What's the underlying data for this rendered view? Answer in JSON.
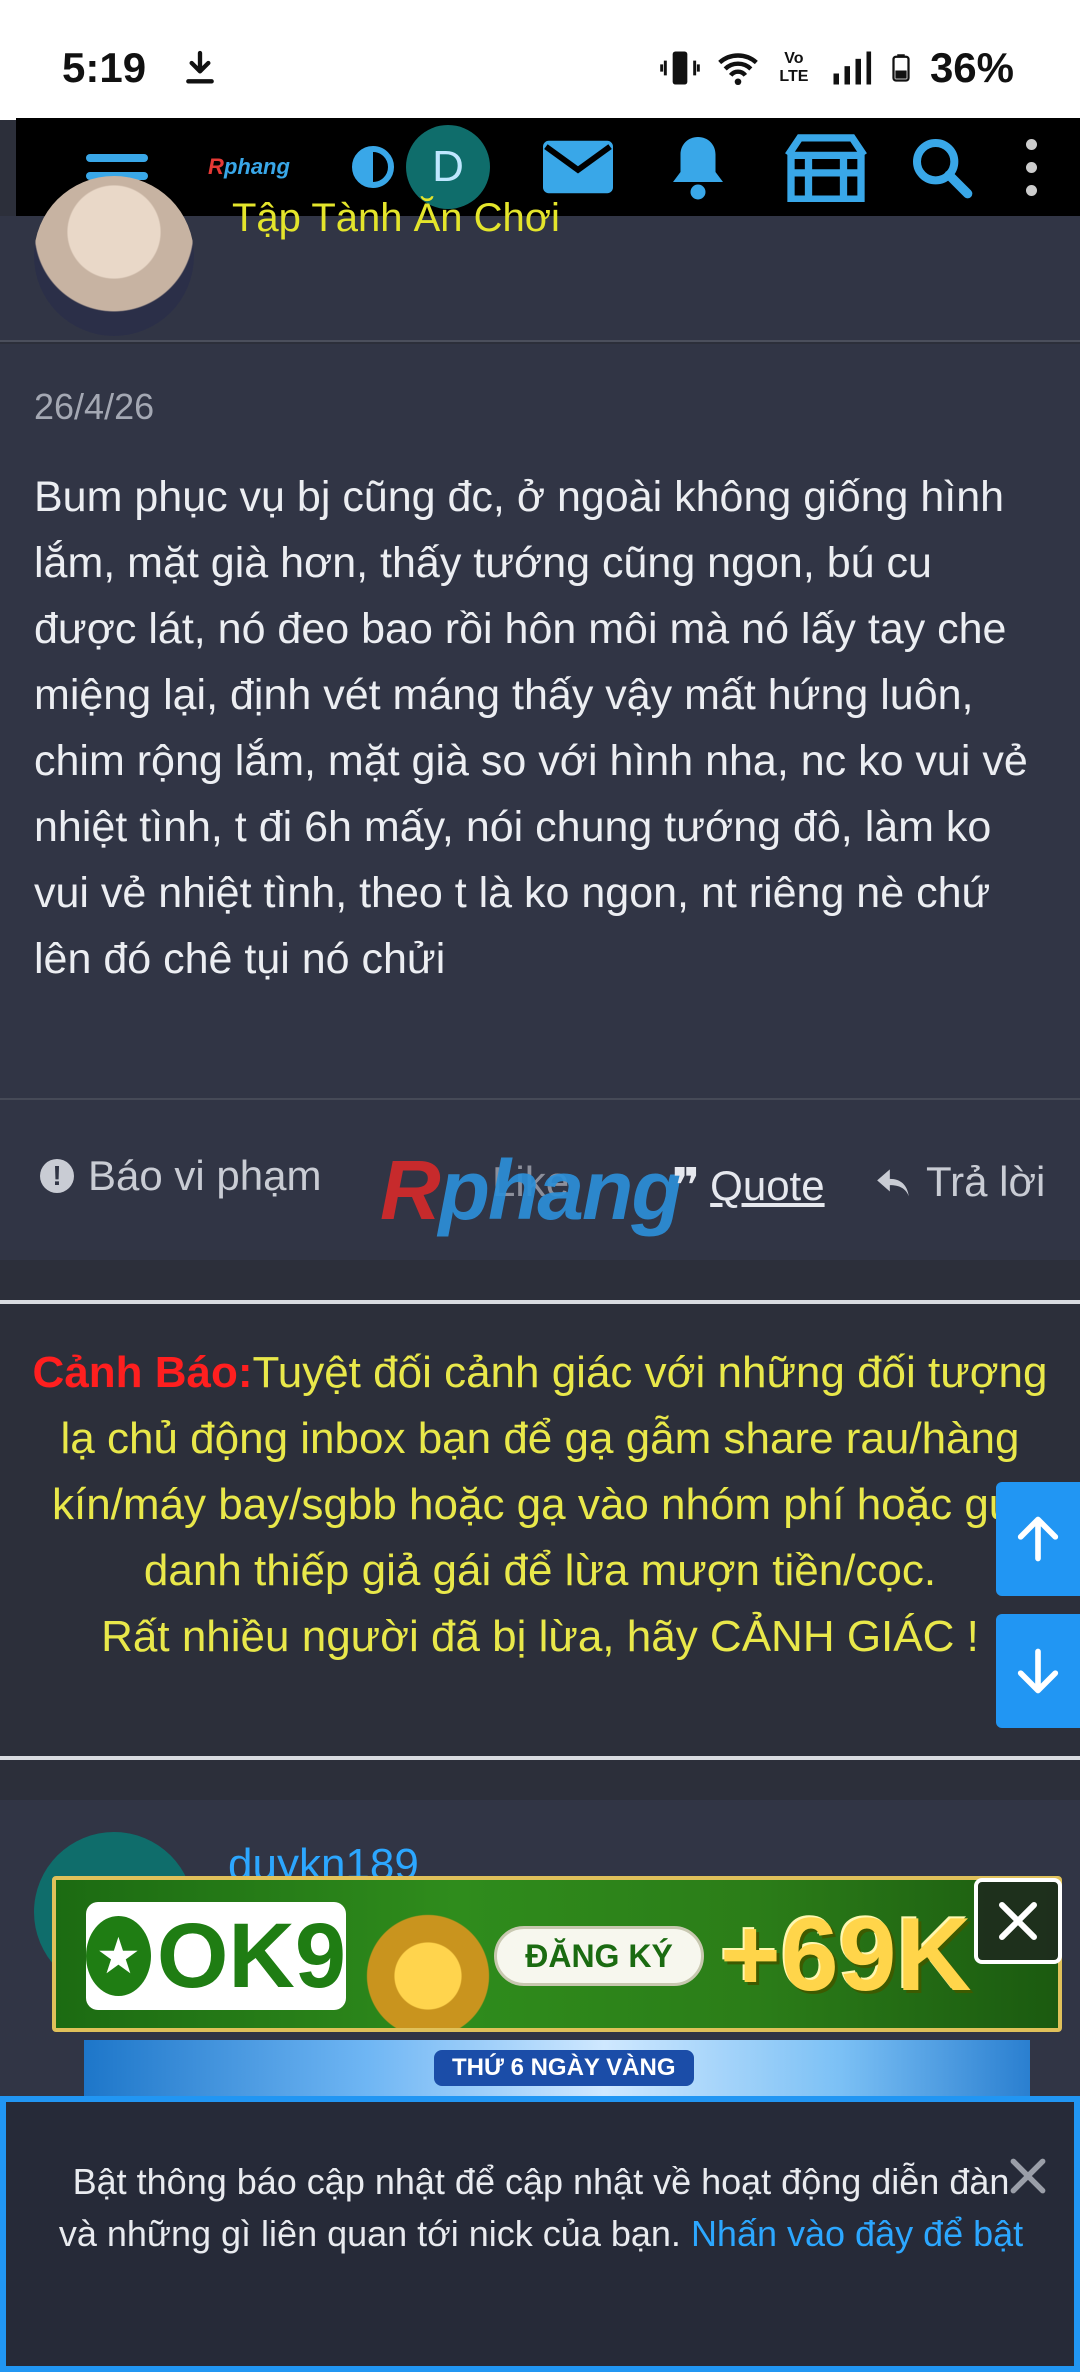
{
  "status_bar": {
    "time": "5:19",
    "volte": "Vo LTE",
    "battery": "36%"
  },
  "topbar": {
    "logo_part1": "R",
    "logo_part2": "phang",
    "avatar_letter": "D"
  },
  "previous_post": {
    "author_title": "Tập Tành Ăn Chơi"
  },
  "post": {
    "date": "26/4/26",
    "body": "Bum phục vụ bj cũng đc, ở ngoài không giống hình lắm, mặt già hơn, thấy tướng cũng ngon, bú cu được lát, nó đeo bao rồi hôn môi mà nó lấy tay che miệng lại, định vét máng thấy vậy mất hứng luôn, chim rộng lắm, mặt già so với hình nha, nc ko vui vẻ nhiệt tình, t đi 6h mấy, nói chung tướng đô, làm ko vui vẻ nhiệt tình, theo t là ko ngon, nt riêng nè chứ lên đó chê tụi nó chửi",
    "actions": {
      "report_label": "Báo vi phạm",
      "like_label": "Like",
      "quote_label": "Quote",
      "reply_label": "Trả lời"
    },
    "watermark_part1": "R",
    "watermark_part2": "phang"
  },
  "warning": {
    "title": "Cảnh Báo:",
    "text": "Tuyệt đối cảnh giác với những đối tượng lạ chủ động inbox bạn để gạ gẫm share rau/hàng kín/máy bay/sgbb hoặc gạ vào nhóm phí hoặc gửi danh thiếp giả gái để lừa mượn tiền/cọc.",
    "text2": "Rất nhiều người đã bị lừa, hãy CẢNH GIÁC !"
  },
  "next_post": {
    "author": "duykn189"
  },
  "ad": {
    "logo_text": "OK9",
    "register_label": "ĐĂNG KÝ",
    "bonus": "+69K",
    "strip_text": "THỨ 6 NGÀY VÀNG"
  },
  "notification": {
    "text": "Bật thông báo cập nhật để cập nhật về hoạt động diễn đàn và những gì liên quan tới nick của bạn.",
    "link": "Nhấn vào đây để bật"
  },
  "colors": {
    "accent": "#2196f3",
    "warning_title": "#ff1f1f",
    "warning_text": "#e9e84a",
    "background": "#2c2f3a"
  }
}
